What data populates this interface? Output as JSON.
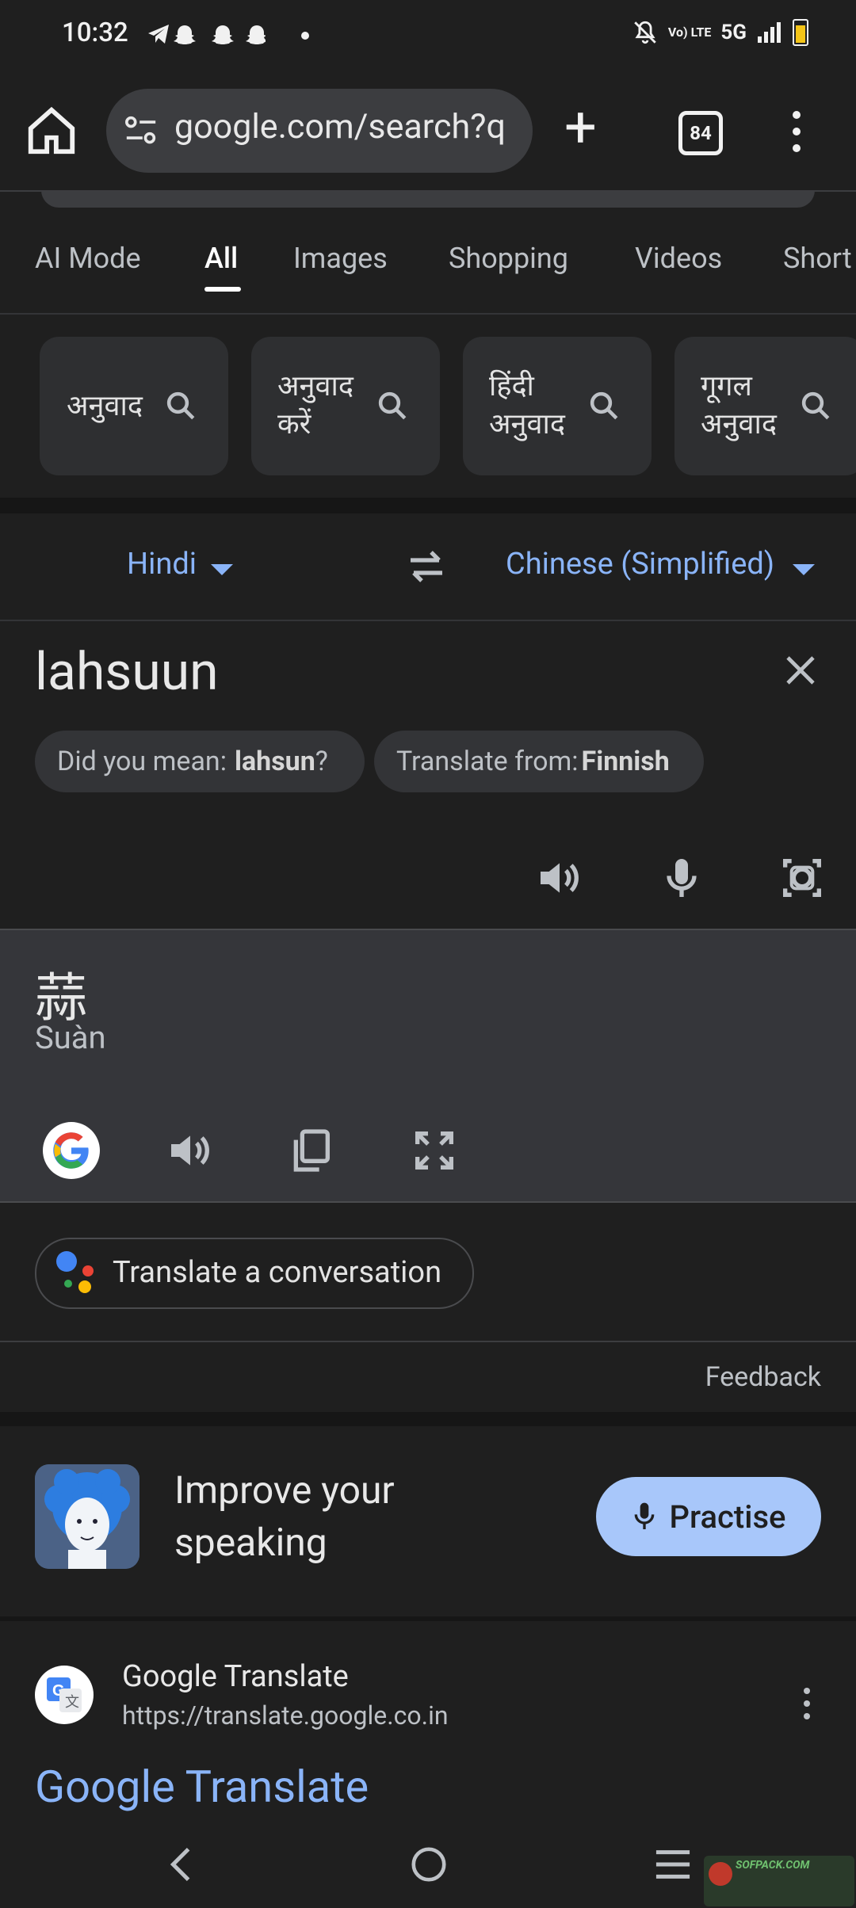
{
  "status_bar": {
    "time": "10:32",
    "network": "5G",
    "volte": "Vo) LTE"
  },
  "browser": {
    "url": "google.com/search?q",
    "tab_count": "84"
  },
  "search_tabs": [
    {
      "label": "AI Mode"
    },
    {
      "label": "All"
    },
    {
      "label": "Images"
    },
    {
      "label": "Shopping"
    },
    {
      "label": "Videos"
    },
    {
      "label": "Short"
    }
  ],
  "chips": [
    {
      "line1": "अनुवाद",
      "line2": ""
    },
    {
      "line1": "अनुवाद",
      "line2": "करें"
    },
    {
      "line1": "हिंदी",
      "line2": "अनुवाद"
    },
    {
      "line1": "गूगल",
      "line2": "अनुवाद"
    }
  ],
  "translate": {
    "source_lang": "Hindi",
    "target_lang": "Chinese (Simplified)",
    "source_text": "lahsuun",
    "did_you_mean_label": "Did you mean:",
    "did_you_mean_value": "lahsun",
    "did_you_mean_suffix": "?",
    "translate_from_label": "Translate from:",
    "translate_from_value": "Finnish",
    "result_text": "蒜",
    "result_romanization": "Suàn",
    "conversation_label": "Translate a conversation",
    "feedback_label": "Feedback"
  },
  "speaking": {
    "title_line1": "Improve your",
    "title_line2": "speaking",
    "button_label": "Practise"
  },
  "search_result": {
    "site_name": "Google Translate",
    "site_url": "https://translate.google.co.in",
    "title": "Google Translate"
  },
  "watermark": {
    "text": "SOFPACK.COM"
  }
}
